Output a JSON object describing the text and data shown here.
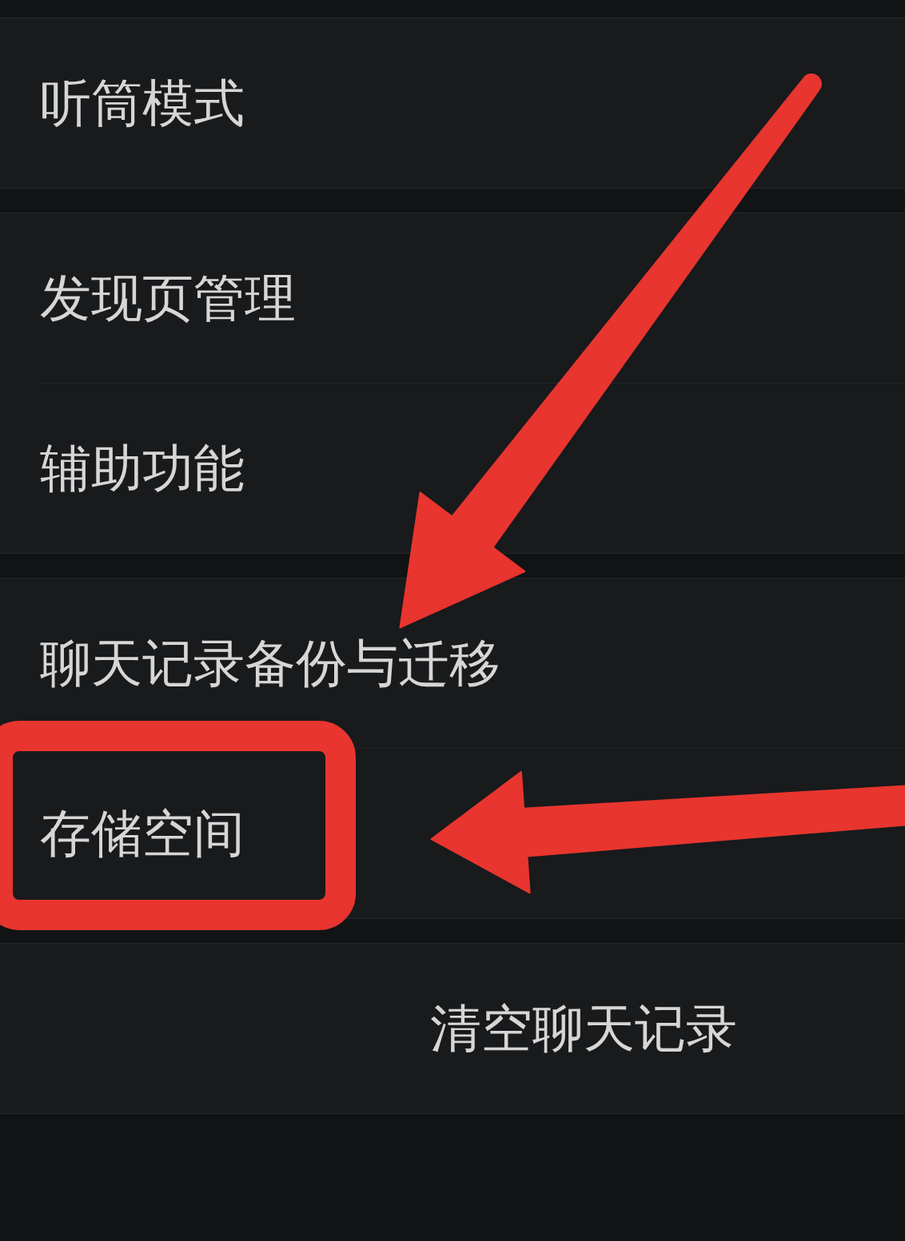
{
  "settings_groups": [
    {
      "items": [
        {
          "label": "听筒模式",
          "highlighted": false
        }
      ]
    },
    {
      "items": [
        {
          "label": "发现页管理",
          "highlighted": false
        },
        {
          "label": "辅助功能",
          "highlighted": false
        }
      ]
    },
    {
      "items": [
        {
          "label": "聊天记录备份与迁移",
          "highlighted": false
        },
        {
          "label": "存储空间",
          "highlighted": true
        }
      ]
    }
  ],
  "action_button": {
    "label": "清空聊天记录"
  },
  "annotations": [
    {
      "kind": "arrow"
    },
    {
      "kind": "arrow"
    }
  ]
}
